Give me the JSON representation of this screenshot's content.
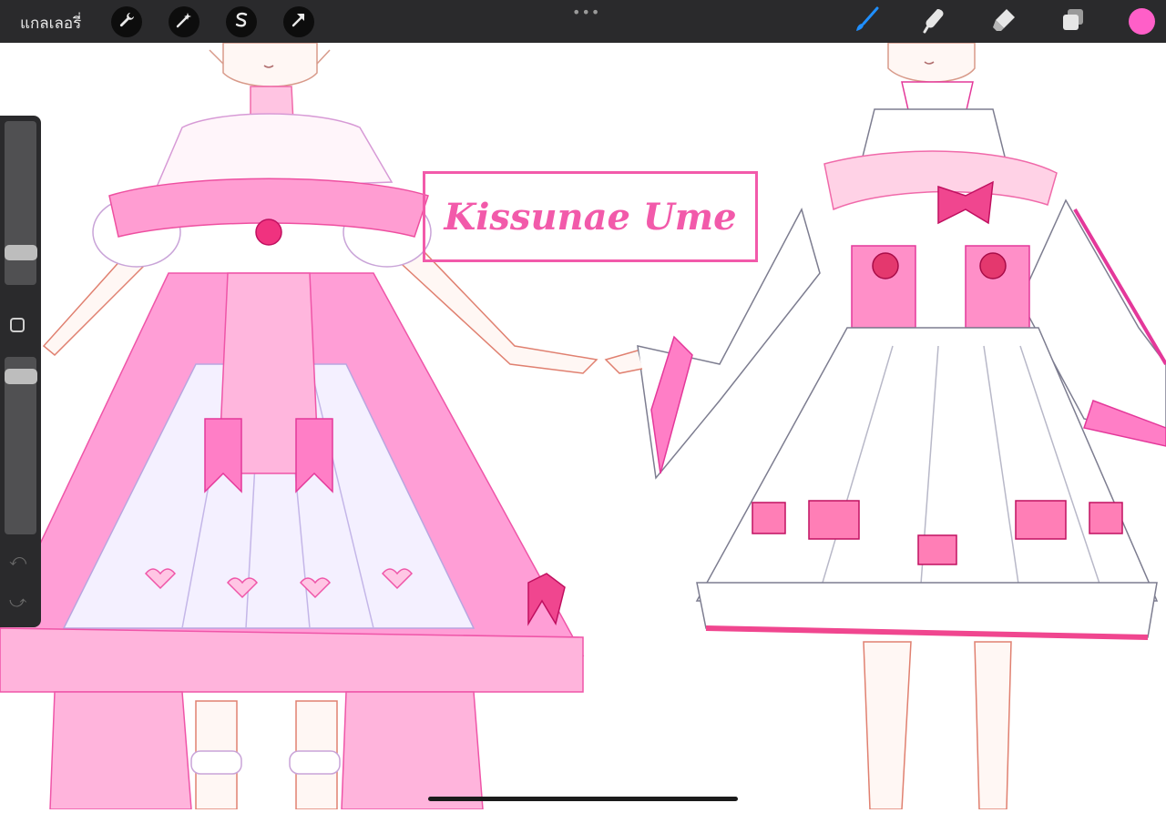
{
  "toolbar": {
    "gallery_label": "แกลเลอรี่",
    "more_menu": "•••",
    "left_tools": [
      {
        "name": "actions",
        "icon": "wrench-icon"
      },
      {
        "name": "adjustments",
        "icon": "magic-wand-icon"
      },
      {
        "name": "selection",
        "icon": "selection-s-icon"
      },
      {
        "name": "transform",
        "icon": "arrow-cursor-icon"
      }
    ],
    "right_tools": [
      {
        "name": "brush",
        "icon": "brush-icon",
        "active": true
      },
      {
        "name": "smudge",
        "icon": "smudge-icon"
      },
      {
        "name": "eraser",
        "icon": "eraser-icon"
      },
      {
        "name": "layers",
        "icon": "layers-icon"
      }
    ],
    "current_color": "#ff5fc8",
    "active_color": "#1f8fff"
  },
  "sidebar": {
    "brush_size_icon": "slider-thumb",
    "modify_icon": "square-icon",
    "opacity_icon": "slider-thumb",
    "undo_icon": "undo-arrow-icon",
    "redo_icon": "redo-arrow-icon"
  },
  "canvas": {
    "name_label": "Kissunae Ume",
    "accent_pink": "#f25aaa",
    "dress_pink": "#ff8fd0"
  }
}
